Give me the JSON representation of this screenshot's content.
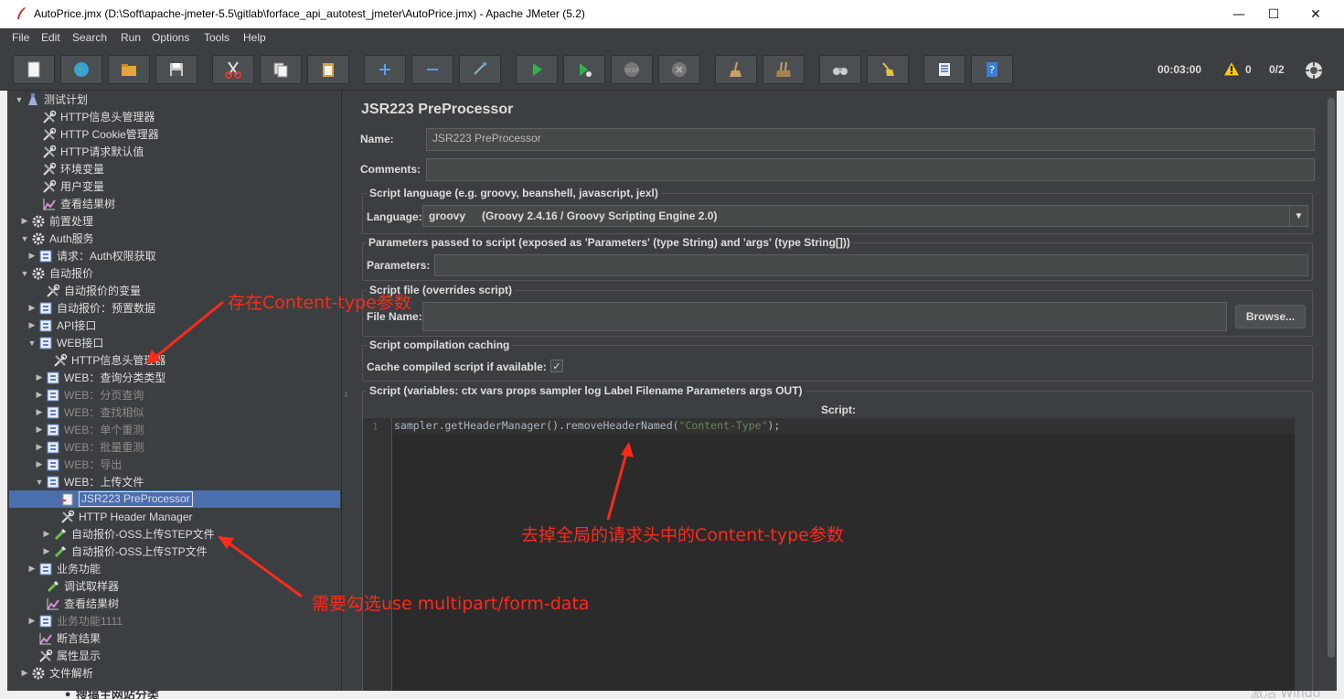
{
  "window": {
    "title": "AutoPrice.jmx (D:\\Soft\\apache-jmeter-5.5\\gitlab\\forface_api_autotest_jmeter\\AutoPrice.jmx) - Apache JMeter (5.2)",
    "minimize": "—",
    "maximize": "☐",
    "close": "✕"
  },
  "menu": [
    "File",
    "Edit",
    "Search",
    "Run",
    "Options",
    "Tools",
    "Help"
  ],
  "toolbar": {
    "icons": [
      "new-icon",
      "templates-icon",
      "open-icon",
      "save-icon",
      "cut-icon",
      "copy-icon",
      "paste-icon",
      "expand-icon",
      "collapse-icon",
      "toggle-icon",
      "start-icon",
      "start-no-pause-icon",
      "stop-icon",
      "shutdown-icon",
      "clear-icon",
      "clear-all-icon",
      "search-icon",
      "reset-search-icon",
      "function-helper-icon",
      "help-icon"
    ],
    "timer": "00:03:00",
    "warnings": "0",
    "threads": "0/2"
  },
  "tree": [
    {
      "label": "测试计划",
      "icon": "test-plan-icon",
      "arrow": "▼",
      "dim": false
    },
    {
      "label": "HTTP信息头管理器",
      "icon": "config-wrench-icon",
      "arrow": "",
      "dim": false
    },
    {
      "label": "HTTP Cookie管理器",
      "icon": "config-wrench-icon",
      "arrow": "",
      "dim": false
    },
    {
      "label": "HTTP请求默认值",
      "icon": "config-wrench-icon",
      "arrow": "",
      "dim": false
    },
    {
      "label": "环境变量",
      "icon": "config-wrench-icon",
      "arrow": "",
      "dim": false
    },
    {
      "label": "用户变量",
      "icon": "config-wrench-icon",
      "arrow": "",
      "dim": false
    },
    {
      "label": "查看结果树",
      "icon": "listener-chart-icon",
      "arrow": "",
      "dim": false
    },
    {
      "label": "前置处理",
      "icon": "thread-group-gear-icon",
      "arrow": "▶",
      "dim": false
    },
    {
      "label": "Auth服务",
      "icon": "thread-group-gear-icon",
      "arrow": "▼",
      "dim": false
    },
    {
      "label": "请求：Auth权限获取",
      "icon": "controller-icon",
      "arrow": "▶",
      "dim": false
    },
    {
      "label": "自动报价",
      "icon": "thread-group-gear-icon",
      "arrow": "▼",
      "dim": false
    },
    {
      "label": "自动报价的变量",
      "icon": "config-wrench-icon",
      "arrow": "",
      "dim": false
    },
    {
      "label": "自动报价：预置数据",
      "icon": "controller-icon",
      "arrow": "▶",
      "dim": false
    },
    {
      "label": "API接口",
      "icon": "controller-icon",
      "arrow": "▶",
      "dim": false
    },
    {
      "label": "WEB接口",
      "icon": "controller-icon",
      "arrow": "▼",
      "dim": false
    },
    {
      "label": "HTTP信息头管理器",
      "icon": "config-wrench-icon",
      "arrow": "",
      "dim": false
    },
    {
      "label": "WEB：查询分类类型",
      "icon": "controller-icon",
      "arrow": "▶",
      "dim": false
    },
    {
      "label": "WEB：分页查询",
      "icon": "controller-icon",
      "arrow": "▶",
      "dim": true
    },
    {
      "label": "WEB：查找相似",
      "icon": "controller-icon",
      "arrow": "▶",
      "dim": true
    },
    {
      "label": "WEB：单个重测",
      "icon": "controller-icon",
      "arrow": "▶",
      "dim": true
    },
    {
      "label": "WEB：批量重测",
      "icon": "controller-icon",
      "arrow": "▶",
      "dim": true
    },
    {
      "label": "WEB：导出",
      "icon": "controller-icon",
      "arrow": "▶",
      "dim": true
    },
    {
      "label": "WEB：上传文件",
      "icon": "controller-icon",
      "arrow": "▼",
      "dim": false
    },
    {
      "label": "JSR223 PreProcessor",
      "icon": "preprocessor-icon",
      "arrow": "",
      "dim": false
    },
    {
      "label": "HTTP Header Manager",
      "icon": "config-wrench-icon",
      "arrow": "",
      "dim": false
    },
    {
      "label": "自动报价-OSS上传STEP文件",
      "icon": "sampler-pipette-icon",
      "arrow": "▶",
      "dim": false
    },
    {
      "label": "自动报价-OSS上传STP文件",
      "icon": "sampler-pipette-icon",
      "arrow": "▶",
      "dim": false
    },
    {
      "label": "业务功能",
      "icon": "controller-icon",
      "arrow": "▶",
      "dim": false
    },
    {
      "label": "调试取样器",
      "icon": "sampler-pipette-icon",
      "arrow": "",
      "dim": false
    },
    {
      "label": "查看结果树",
      "icon": "listener-chart-icon",
      "arrow": "",
      "dim": false
    },
    {
      "label": "业务功能1111",
      "icon": "controller-icon",
      "arrow": "▶",
      "dim": true
    },
    {
      "label": "断言结果",
      "icon": "listener-chart-icon",
      "arrow": "",
      "dim": false
    },
    {
      "label": "属性显示",
      "icon": "config-wrench-icon",
      "arrow": "",
      "dim": false
    },
    {
      "label": "文件解析",
      "icon": "thread-group-gear-icon",
      "arrow": "▶",
      "dim": false
    }
  ],
  "editor": {
    "heading": "JSR223 PreProcessor",
    "name_label": "Name:",
    "name_value": "JSR223 PreProcessor",
    "comments_label": "Comments:",
    "comments_value": "",
    "lang_group": "Script language (e.g. groovy, beanshell, javascript, jexl)",
    "lang_label": "Language:",
    "lang_value": "groovy",
    "lang_desc": "(Groovy 2.4.16 / Groovy Scripting Engine 2.0)",
    "params_group": "Parameters passed to script (exposed as 'Parameters' (type String) and 'args' (type String[]))",
    "params_label": "Parameters:",
    "params_value": "",
    "file_group": "Script file (overrides script)",
    "file_label": "File Name:",
    "file_value": "",
    "browse": "Browse...",
    "cache_group": "Script compilation caching",
    "cache_label": "Cache compiled script if available:",
    "cache_checked": "✓",
    "script_group": "Script (variables: ctx vars props sampler log Label Filename Parameters args OUT)",
    "script_label": "Script:",
    "line_no": "1",
    "code_pre": "sampler.getHeaderManager().removeHeaderNamed(",
    "code_str": "\"Content-Type\"",
    "code_post": ");"
  },
  "annotations": {
    "a1": "存在Content-type参数",
    "a2": "去掉全局的请求头中的Content-type参数",
    "a3": "需要勾选use multipart/form-data",
    "color": "#ff2a1a"
  },
  "bottom": {
    "ghost": "• 搜搞主网站分类",
    "ghost2": "激活 Windo"
  }
}
